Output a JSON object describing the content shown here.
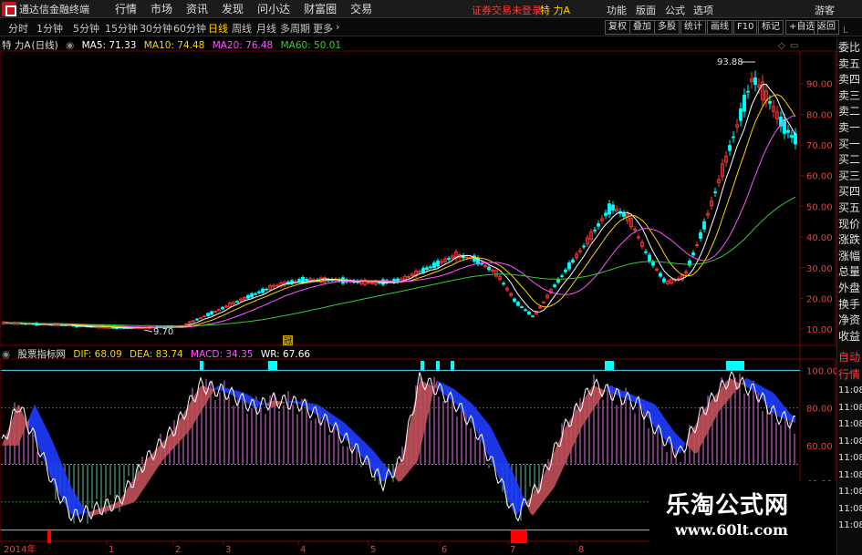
{
  "app": {
    "title": "通达信金融终端"
  },
  "menu": [
    "行情",
    "市场",
    "资讯",
    "发现",
    "问小达",
    "财富圈",
    "交易"
  ],
  "top_status": "证券交易未登录",
  "top_stock": "特 力A",
  "tools": [
    "功能",
    "版面",
    "公式",
    "选项"
  ],
  "guest": "游客",
  "periods": [
    "分时",
    "1分钟",
    "5分钟",
    "15分钟",
    "30分钟",
    "60分钟",
    "日线",
    "周线",
    "月线",
    "多周期",
    "更多"
  ],
  "active_period": "日线",
  "right_buttons": [
    "复权",
    "叠加",
    "多股",
    "统计",
    "画线",
    "F10",
    "标记",
    "+自选",
    "返回"
  ],
  "main_chart": {
    "stock": "特 力A",
    "period": "(日线)",
    "ma5": "MA5: 71.33",
    "ma10": "MA10: 74.48",
    "ma20": "MA20: 76.48",
    "ma60": "MA60: 50.01",
    "high_label": "93.88",
    "low_label": "9.70",
    "marker_label": "冠",
    "y_ticks": [
      "90.00",
      "80.00",
      "70.00",
      "60.00",
      "50.00",
      "40.00",
      "30.00",
      "20.00",
      "10.00"
    ],
    "y_range": [
      5,
      100
    ],
    "colors": {
      "up": "#ff3c3c",
      "down": "#00ffff",
      "ma5": "#ffffff",
      "ma10": "#ffd200",
      "ma20": "#ff55ff",
      "ma60": "#33cc33"
    }
  },
  "sub_chart": {
    "name": "股票指标网",
    "dif": "DIF: 68.09",
    "dea": "DEA: 83.74",
    "macd": "MACD: 34.35",
    "wr": "WR: 67.66",
    "y_ticks": [
      "100.00",
      "80.00",
      "60.00",
      "40.00"
    ],
    "y_range": [
      10,
      105
    ]
  },
  "x_axis": {
    "labels": [
      "2014年",
      "1",
      "2",
      "3",
      "4",
      "5",
      "6",
      "7",
      "8"
    ]
  },
  "right_column": [
    "委比",
    "卖五",
    "卖四",
    "卖三",
    "卖二",
    "卖一",
    "买一",
    "买二",
    "买三",
    "买四",
    "买五",
    "现价",
    "涨跌",
    "涨幅",
    "总量",
    "外盘",
    "换手",
    "净资",
    "收益"
  ],
  "right_column_lower": [
    "自动",
    "行情",
    "11:08",
    "11:08",
    "11:08",
    "11:08",
    "11:08",
    "11:08",
    "11:08",
    "11:08",
    "11:08"
  ],
  "watermark": {
    "title": "乐淘公式网",
    "url": "www.60lt.com"
  }
}
